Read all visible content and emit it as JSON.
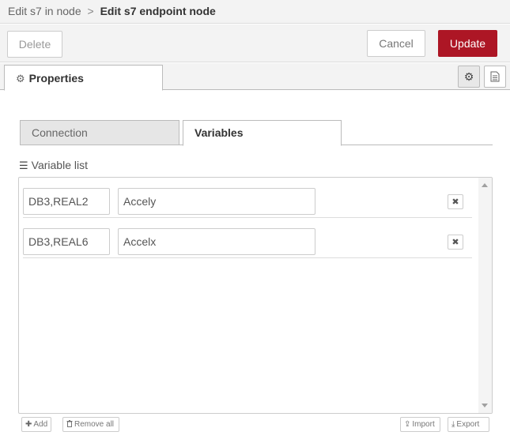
{
  "breadcrumb": {
    "previous": "Edit s7 in node",
    "separator": ">",
    "current": "Edit s7 endpoint node"
  },
  "toolbar": {
    "delete_label": "Delete",
    "cancel_label": "Cancel",
    "update_label": "Update"
  },
  "tabs": {
    "properties_label": "Properties"
  },
  "sub_tabs": {
    "connection_label": "Connection",
    "variables_label": "Variables",
    "active": "Variables"
  },
  "variable_list": {
    "label": "Variable list",
    "rows": [
      {
        "address": "DB3,REAL2",
        "name": "Accely"
      },
      {
        "address": "DB3,REAL6",
        "name": "Accelx"
      }
    ]
  },
  "list_actions": {
    "add_label": "Add",
    "remove_all_label": "Remove all",
    "import_label": "Import",
    "export_label": "Export"
  },
  "icons": {
    "settings": "gear-icon",
    "info": "document-icon",
    "list": "list-icon",
    "remove": "close-icon",
    "add": "plus-icon",
    "trash": "trash-icon",
    "import": "upload-icon",
    "export": "download-icon"
  },
  "colors": {
    "accent": "#ad1625",
    "header_bg": "#f3f3f3",
    "border": "#cccccc"
  }
}
